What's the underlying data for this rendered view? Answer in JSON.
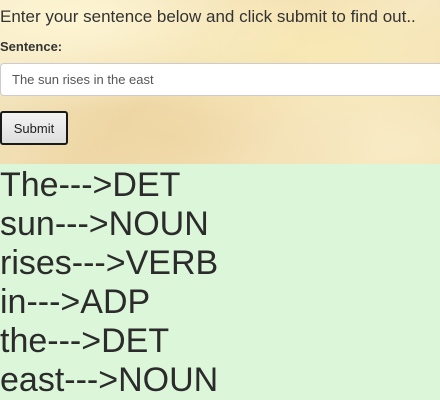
{
  "form": {
    "intro_text": "Enter your sentence below and click submit to find out..",
    "sentence_label": "Sentence:",
    "sentence_value": "The sun rises in the east",
    "submit_label": "Submit"
  },
  "results": {
    "lines": [
      "The--->DET",
      "sun--->NOUN",
      "rises--->VERB",
      "in--->ADP",
      "the--->DET",
      "east--->NOUN"
    ]
  },
  "colors": {
    "results_background": "#dcf6d9",
    "text": "#333333"
  }
}
